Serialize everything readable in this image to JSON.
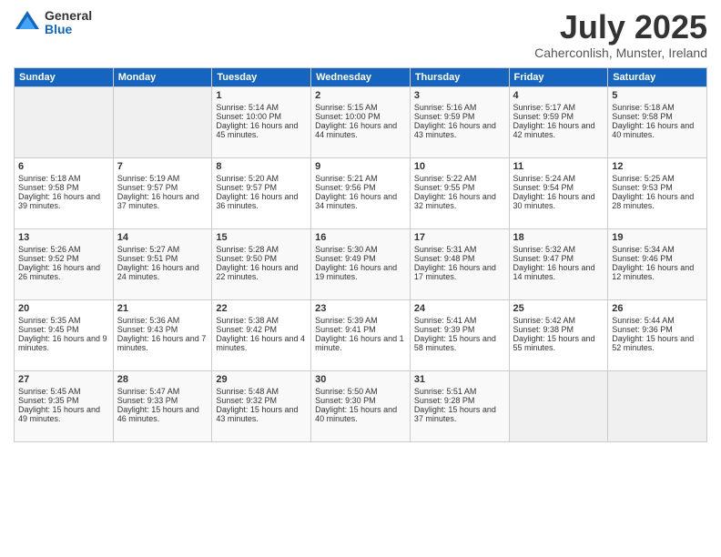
{
  "logo": {
    "general": "General",
    "blue": "Blue"
  },
  "title": "July 2025",
  "subtitle": "Caherconlish, Munster, Ireland",
  "days_of_week": [
    "Sunday",
    "Monday",
    "Tuesday",
    "Wednesday",
    "Thursday",
    "Friday",
    "Saturday"
  ],
  "weeks": [
    [
      {
        "day": "",
        "content": ""
      },
      {
        "day": "",
        "content": ""
      },
      {
        "day": "1",
        "content": "Sunrise: 5:14 AM\nSunset: 10:00 PM\nDaylight: 16 hours and 45 minutes."
      },
      {
        "day": "2",
        "content": "Sunrise: 5:15 AM\nSunset: 10:00 PM\nDaylight: 16 hours and 44 minutes."
      },
      {
        "day": "3",
        "content": "Sunrise: 5:16 AM\nSunset: 9:59 PM\nDaylight: 16 hours and 43 minutes."
      },
      {
        "day": "4",
        "content": "Sunrise: 5:17 AM\nSunset: 9:59 PM\nDaylight: 16 hours and 42 minutes."
      },
      {
        "day": "5",
        "content": "Sunrise: 5:18 AM\nSunset: 9:58 PM\nDaylight: 16 hours and 40 minutes."
      }
    ],
    [
      {
        "day": "6",
        "content": "Sunrise: 5:18 AM\nSunset: 9:58 PM\nDaylight: 16 hours and 39 minutes."
      },
      {
        "day": "7",
        "content": "Sunrise: 5:19 AM\nSunset: 9:57 PM\nDaylight: 16 hours and 37 minutes."
      },
      {
        "day": "8",
        "content": "Sunrise: 5:20 AM\nSunset: 9:57 PM\nDaylight: 16 hours and 36 minutes."
      },
      {
        "day": "9",
        "content": "Sunrise: 5:21 AM\nSunset: 9:56 PM\nDaylight: 16 hours and 34 minutes."
      },
      {
        "day": "10",
        "content": "Sunrise: 5:22 AM\nSunset: 9:55 PM\nDaylight: 16 hours and 32 minutes."
      },
      {
        "day": "11",
        "content": "Sunrise: 5:24 AM\nSunset: 9:54 PM\nDaylight: 16 hours and 30 minutes."
      },
      {
        "day": "12",
        "content": "Sunrise: 5:25 AM\nSunset: 9:53 PM\nDaylight: 16 hours and 28 minutes."
      }
    ],
    [
      {
        "day": "13",
        "content": "Sunrise: 5:26 AM\nSunset: 9:52 PM\nDaylight: 16 hours and 26 minutes."
      },
      {
        "day": "14",
        "content": "Sunrise: 5:27 AM\nSunset: 9:51 PM\nDaylight: 16 hours and 24 minutes."
      },
      {
        "day": "15",
        "content": "Sunrise: 5:28 AM\nSunset: 9:50 PM\nDaylight: 16 hours and 22 minutes."
      },
      {
        "day": "16",
        "content": "Sunrise: 5:30 AM\nSunset: 9:49 PM\nDaylight: 16 hours and 19 minutes."
      },
      {
        "day": "17",
        "content": "Sunrise: 5:31 AM\nSunset: 9:48 PM\nDaylight: 16 hours and 17 minutes."
      },
      {
        "day": "18",
        "content": "Sunrise: 5:32 AM\nSunset: 9:47 PM\nDaylight: 16 hours and 14 minutes."
      },
      {
        "day": "19",
        "content": "Sunrise: 5:34 AM\nSunset: 9:46 PM\nDaylight: 16 hours and 12 minutes."
      }
    ],
    [
      {
        "day": "20",
        "content": "Sunrise: 5:35 AM\nSunset: 9:45 PM\nDaylight: 16 hours and 9 minutes."
      },
      {
        "day": "21",
        "content": "Sunrise: 5:36 AM\nSunset: 9:43 PM\nDaylight: 16 hours and 7 minutes."
      },
      {
        "day": "22",
        "content": "Sunrise: 5:38 AM\nSunset: 9:42 PM\nDaylight: 16 hours and 4 minutes."
      },
      {
        "day": "23",
        "content": "Sunrise: 5:39 AM\nSunset: 9:41 PM\nDaylight: 16 hours and 1 minute."
      },
      {
        "day": "24",
        "content": "Sunrise: 5:41 AM\nSunset: 9:39 PM\nDaylight: 15 hours and 58 minutes."
      },
      {
        "day": "25",
        "content": "Sunrise: 5:42 AM\nSunset: 9:38 PM\nDaylight: 15 hours and 55 minutes."
      },
      {
        "day": "26",
        "content": "Sunrise: 5:44 AM\nSunset: 9:36 PM\nDaylight: 15 hours and 52 minutes."
      }
    ],
    [
      {
        "day": "27",
        "content": "Sunrise: 5:45 AM\nSunset: 9:35 PM\nDaylight: 15 hours and 49 minutes."
      },
      {
        "day": "28",
        "content": "Sunrise: 5:47 AM\nSunset: 9:33 PM\nDaylight: 15 hours and 46 minutes."
      },
      {
        "day": "29",
        "content": "Sunrise: 5:48 AM\nSunset: 9:32 PM\nDaylight: 15 hours and 43 minutes."
      },
      {
        "day": "30",
        "content": "Sunrise: 5:50 AM\nSunset: 9:30 PM\nDaylight: 15 hours and 40 minutes."
      },
      {
        "day": "31",
        "content": "Sunrise: 5:51 AM\nSunset: 9:28 PM\nDaylight: 15 hours and 37 minutes."
      },
      {
        "day": "",
        "content": ""
      },
      {
        "day": "",
        "content": ""
      }
    ]
  ]
}
